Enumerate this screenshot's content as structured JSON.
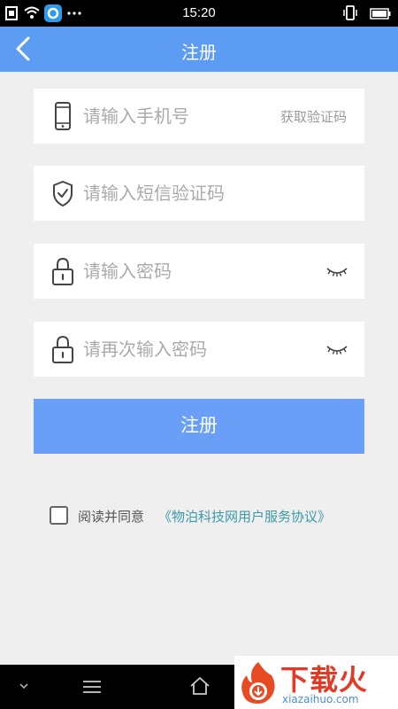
{
  "status_bar": {
    "time": "15:20"
  },
  "header": {
    "title": "注册"
  },
  "form": {
    "phone": {
      "placeholder": "请输入手机号",
      "get_code": "获取验证码"
    },
    "sms_code": {
      "placeholder": "请输入短信验证码"
    },
    "password": {
      "placeholder": "请输入密码"
    },
    "confirm_password": {
      "placeholder": "请再次输入密码"
    },
    "submit_label": "注册"
  },
  "agreement": {
    "checked": false,
    "label": "阅读并同意",
    "link": "《物泊科技网用户服务协议》"
  },
  "watermark": {
    "text": "下载火",
    "url": "xiazaihuo.com"
  },
  "colors": {
    "primary": "#5d9cf3",
    "button": "#6a9ff8",
    "link": "#3a9aa8",
    "background": "#efefef"
  }
}
